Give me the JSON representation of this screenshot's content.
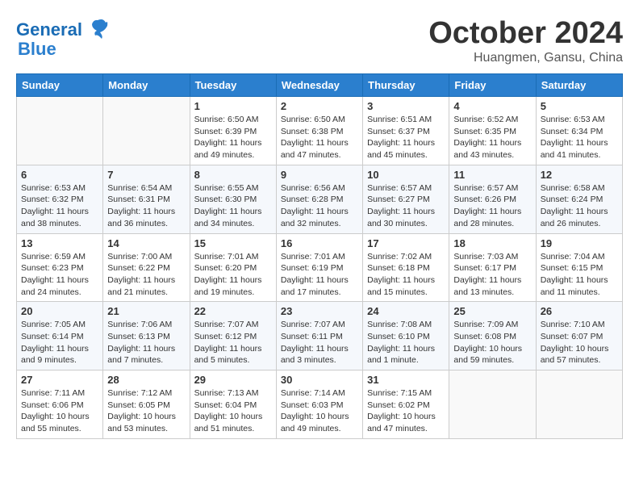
{
  "logo": {
    "line1": "General",
    "line2": "Blue"
  },
  "title": "October 2024",
  "location": "Huangmen, Gansu, China",
  "weekdays": [
    "Sunday",
    "Monday",
    "Tuesday",
    "Wednesday",
    "Thursday",
    "Friday",
    "Saturday"
  ],
  "weeks": [
    [
      {
        "day": null
      },
      {
        "day": null
      },
      {
        "day": "1",
        "sunrise": "6:50 AM",
        "sunset": "6:39 PM",
        "daylight": "11 hours and 49 minutes."
      },
      {
        "day": "2",
        "sunrise": "6:50 AM",
        "sunset": "6:38 PM",
        "daylight": "11 hours and 47 minutes."
      },
      {
        "day": "3",
        "sunrise": "6:51 AM",
        "sunset": "6:37 PM",
        "daylight": "11 hours and 45 minutes."
      },
      {
        "day": "4",
        "sunrise": "6:52 AM",
        "sunset": "6:35 PM",
        "daylight": "11 hours and 43 minutes."
      },
      {
        "day": "5",
        "sunrise": "6:53 AM",
        "sunset": "6:34 PM",
        "daylight": "11 hours and 41 minutes."
      }
    ],
    [
      {
        "day": "6",
        "sunrise": "6:53 AM",
        "sunset": "6:32 PM",
        "daylight": "11 hours and 38 minutes."
      },
      {
        "day": "7",
        "sunrise": "6:54 AM",
        "sunset": "6:31 PM",
        "daylight": "11 hours and 36 minutes."
      },
      {
        "day": "8",
        "sunrise": "6:55 AM",
        "sunset": "6:30 PM",
        "daylight": "11 hours and 34 minutes."
      },
      {
        "day": "9",
        "sunrise": "6:56 AM",
        "sunset": "6:28 PM",
        "daylight": "11 hours and 32 minutes."
      },
      {
        "day": "10",
        "sunrise": "6:57 AM",
        "sunset": "6:27 PM",
        "daylight": "11 hours and 30 minutes."
      },
      {
        "day": "11",
        "sunrise": "6:57 AM",
        "sunset": "6:26 PM",
        "daylight": "11 hours and 28 minutes."
      },
      {
        "day": "12",
        "sunrise": "6:58 AM",
        "sunset": "6:24 PM",
        "daylight": "11 hours and 26 minutes."
      }
    ],
    [
      {
        "day": "13",
        "sunrise": "6:59 AM",
        "sunset": "6:23 PM",
        "daylight": "11 hours and 24 minutes."
      },
      {
        "day": "14",
        "sunrise": "7:00 AM",
        "sunset": "6:22 PM",
        "daylight": "11 hours and 21 minutes."
      },
      {
        "day": "15",
        "sunrise": "7:01 AM",
        "sunset": "6:20 PM",
        "daylight": "11 hours and 19 minutes."
      },
      {
        "day": "16",
        "sunrise": "7:01 AM",
        "sunset": "6:19 PM",
        "daylight": "11 hours and 17 minutes."
      },
      {
        "day": "17",
        "sunrise": "7:02 AM",
        "sunset": "6:18 PM",
        "daylight": "11 hours and 15 minutes."
      },
      {
        "day": "18",
        "sunrise": "7:03 AM",
        "sunset": "6:17 PM",
        "daylight": "11 hours and 13 minutes."
      },
      {
        "day": "19",
        "sunrise": "7:04 AM",
        "sunset": "6:15 PM",
        "daylight": "11 hours and 11 minutes."
      }
    ],
    [
      {
        "day": "20",
        "sunrise": "7:05 AM",
        "sunset": "6:14 PM",
        "daylight": "11 hours and 9 minutes."
      },
      {
        "day": "21",
        "sunrise": "7:06 AM",
        "sunset": "6:13 PM",
        "daylight": "11 hours and 7 minutes."
      },
      {
        "day": "22",
        "sunrise": "7:07 AM",
        "sunset": "6:12 PM",
        "daylight": "11 hours and 5 minutes."
      },
      {
        "day": "23",
        "sunrise": "7:07 AM",
        "sunset": "6:11 PM",
        "daylight": "11 hours and 3 minutes."
      },
      {
        "day": "24",
        "sunrise": "7:08 AM",
        "sunset": "6:10 PM",
        "daylight": "11 hours and 1 minute."
      },
      {
        "day": "25",
        "sunrise": "7:09 AM",
        "sunset": "6:08 PM",
        "daylight": "10 hours and 59 minutes."
      },
      {
        "day": "26",
        "sunrise": "7:10 AM",
        "sunset": "6:07 PM",
        "daylight": "10 hours and 57 minutes."
      }
    ],
    [
      {
        "day": "27",
        "sunrise": "7:11 AM",
        "sunset": "6:06 PM",
        "daylight": "10 hours and 55 minutes."
      },
      {
        "day": "28",
        "sunrise": "7:12 AM",
        "sunset": "6:05 PM",
        "daylight": "10 hours and 53 minutes."
      },
      {
        "day": "29",
        "sunrise": "7:13 AM",
        "sunset": "6:04 PM",
        "daylight": "10 hours and 51 minutes."
      },
      {
        "day": "30",
        "sunrise": "7:14 AM",
        "sunset": "6:03 PM",
        "daylight": "10 hours and 49 minutes."
      },
      {
        "day": "31",
        "sunrise": "7:15 AM",
        "sunset": "6:02 PM",
        "daylight": "10 hours and 47 minutes."
      },
      {
        "day": null
      },
      {
        "day": null
      }
    ]
  ]
}
